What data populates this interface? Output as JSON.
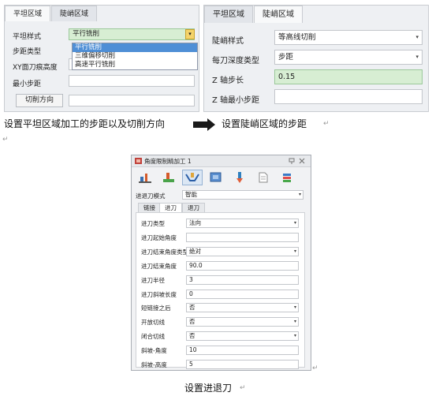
{
  "panel_a": {
    "tabs": [
      "平坦区域",
      "陡峭区域"
    ],
    "rows": [
      {
        "label": "平坦样式",
        "value": "平行铣削"
      },
      {
        "label": "步距类型",
        "value": ""
      },
      {
        "label": "XY面刀痕高度",
        "value": ""
      },
      {
        "label": "最小步距",
        "value": ""
      }
    ],
    "dropdown_options": [
      "平行铣削",
      "三维偏移切削",
      "高速平行铣削"
    ],
    "cut_direction_button": "切削方向",
    "dropdown_arrow": "▾"
  },
  "panel_b": {
    "tabs": [
      "平坦区域",
      "陡峭区域"
    ],
    "rows": [
      {
        "label": "陡峭样式",
        "value": "等高线切削",
        "type": "select"
      },
      {
        "label": "每刀深度类型",
        "value": "步距",
        "type": "select"
      },
      {
        "label": "Z 轴步长",
        "value": "0.15",
        "type": "input-active"
      },
      {
        "label": "Z 轴最小步距",
        "value": "",
        "type": "input"
      }
    ],
    "caret": "▾"
  },
  "captions": {
    "left": "设置平坦区域加工的步距以及切削方向",
    "right": "设置陡峭区域的步距",
    "bottom": "设置进退刀",
    "para_mark": "↵"
  },
  "dialog": {
    "title": "角度限制精加工 1",
    "title_icons": [
      "pin-icon",
      "close-icon"
    ],
    "toolbar_icons": [
      "tool-icon",
      "stock-icon",
      "toolpath-icon",
      "bounds-icon",
      "cutter-icon",
      "document-icon",
      "layers-icon"
    ],
    "mode_label": "进退刀模式",
    "mode_value": "智能",
    "subtabs": [
      "链接",
      "进刀",
      "退刀"
    ],
    "rows": [
      {
        "label": "进刀类型",
        "value": "法向",
        "dropdown": true
      },
      {
        "label": "进刀起始角度",
        "value": "",
        "dropdown": false
      },
      {
        "label": "进刀结束角度类型",
        "value": "绝对",
        "dropdown": true
      },
      {
        "label": "进刀结束角度",
        "value": "90.0",
        "dropdown": false
      },
      {
        "label": "进刀半径",
        "value": "3",
        "dropdown": false
      },
      {
        "label": "进刀斜坡长度",
        "value": "0",
        "dropdown": false
      },
      {
        "label": "短链接之后",
        "value": "否",
        "dropdown": true
      },
      {
        "label": "开放切线",
        "value": "否",
        "dropdown": true
      },
      {
        "label": "闭合切线",
        "value": "否",
        "dropdown": true
      },
      {
        "label": "斜坡-角度",
        "value": "10",
        "dropdown": false
      },
      {
        "label": "斜坡-高度",
        "value": "5",
        "dropdown": false
      }
    ]
  }
}
